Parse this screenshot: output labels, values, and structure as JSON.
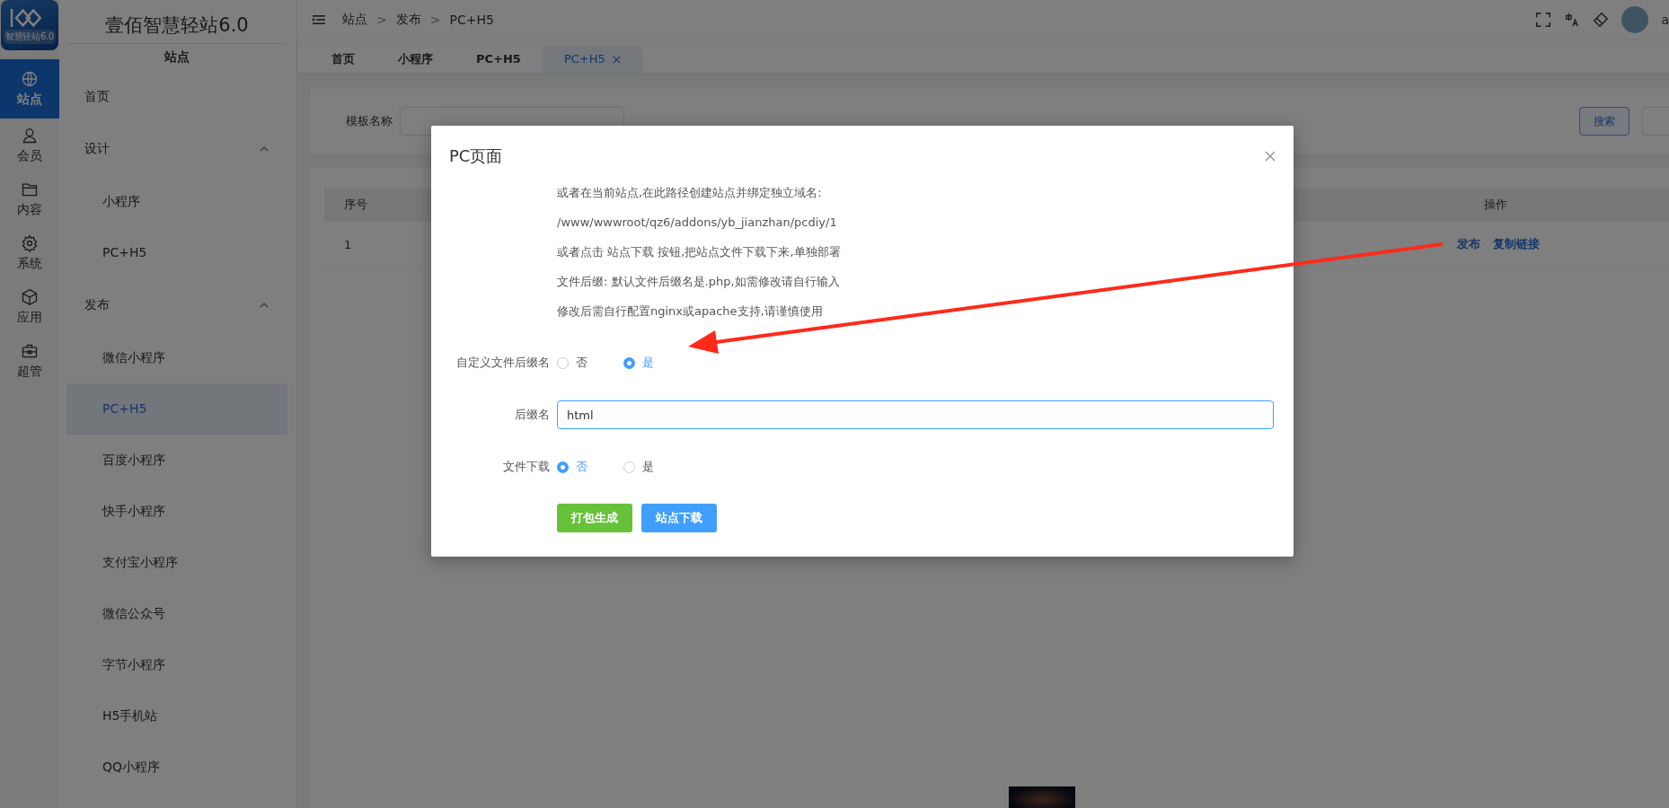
{
  "brand": {
    "logo_text": "智慧轻站6.0",
    "title": "壹佰智慧轻站6.0",
    "section": "站点"
  },
  "rail": [
    {
      "label": "站点",
      "kind": "globe",
      "selected": true
    },
    {
      "label": "会员",
      "kind": "user",
      "selected": false
    },
    {
      "label": "内容",
      "kind": "folder",
      "selected": false
    },
    {
      "label": "系统",
      "kind": "gear",
      "selected": false
    },
    {
      "label": "应用",
      "kind": "box",
      "selected": false
    },
    {
      "label": "超管",
      "kind": "toolbox",
      "selected": false
    }
  ],
  "menu": [
    {
      "label": "首页",
      "selected": false
    },
    {
      "label": "设计",
      "expanded": true,
      "children": [
        {
          "label": "小程序",
          "selected": false
        },
        {
          "label": "PC+H5",
          "selected": false
        }
      ]
    },
    {
      "label": "发布",
      "expanded": true,
      "children": [
        {
          "label": "微信小程序",
          "selected": false
        },
        {
          "label": "PC+H5",
          "selected": true
        },
        {
          "label": "百度小程序",
          "selected": false
        },
        {
          "label": "快手小程序",
          "selected": false
        },
        {
          "label": "支付宝小程序",
          "selected": false
        },
        {
          "label": "微信公众号",
          "selected": false
        },
        {
          "label": "字节小程序",
          "selected": false
        },
        {
          "label": "H5手机站",
          "selected": false
        },
        {
          "label": "QQ小程序",
          "selected": false
        }
      ]
    }
  ],
  "breadcrumb": {
    "separator": ">",
    "items": [
      "站点",
      "发布",
      "PC+H5"
    ]
  },
  "header": {
    "user": "a"
  },
  "tabs": [
    {
      "label": "首页",
      "selected": false,
      "closable": false
    },
    {
      "label": "小程序",
      "selected": false,
      "closable": false
    },
    {
      "label": "PC+H5",
      "selected": false,
      "closable": false
    },
    {
      "label": "PC+H5",
      "selected": true,
      "closable": true
    }
  ],
  "search": {
    "label": "模板名称",
    "button": "搜索"
  },
  "table": {
    "columns": [
      "序号",
      "操作"
    ],
    "rows": [
      {
        "index": "1",
        "actions": [
          "发布",
          "复制链接"
        ]
      }
    ]
  },
  "dialog": {
    "title": "PC页面",
    "notes": [
      "或者在当前站点,在此路径创建站点并绑定独立域名:",
      "/www/wwwroot/qz6/addons/yb_jianzhan/pcdiy/1",
      "或者点击 站点下载 按钮,把站点文件下载下来,单独部署",
      "文件后缀: 默认文件后缀名是.php,如需修改请自行输入",
      "修改后需自行配置nginx或apache支持,请谨慎使用"
    ],
    "fields": [
      {
        "kind": "radio",
        "label": "自定义文件后缀名",
        "options": [
          {
            "label": "否",
            "selected": false
          },
          {
            "label": "是",
            "selected": true
          }
        ]
      },
      {
        "kind": "text",
        "label": "后缀名",
        "value": "html"
      },
      {
        "kind": "radio",
        "label": "文件下载",
        "options": [
          {
            "label": "否",
            "selected": true
          },
          {
            "label": "是",
            "selected": false
          }
        ]
      }
    ],
    "buttons": [
      {
        "label": "打包生成",
        "kind": "success"
      },
      {
        "label": "站点下载",
        "kind": "primary"
      }
    ]
  }
}
